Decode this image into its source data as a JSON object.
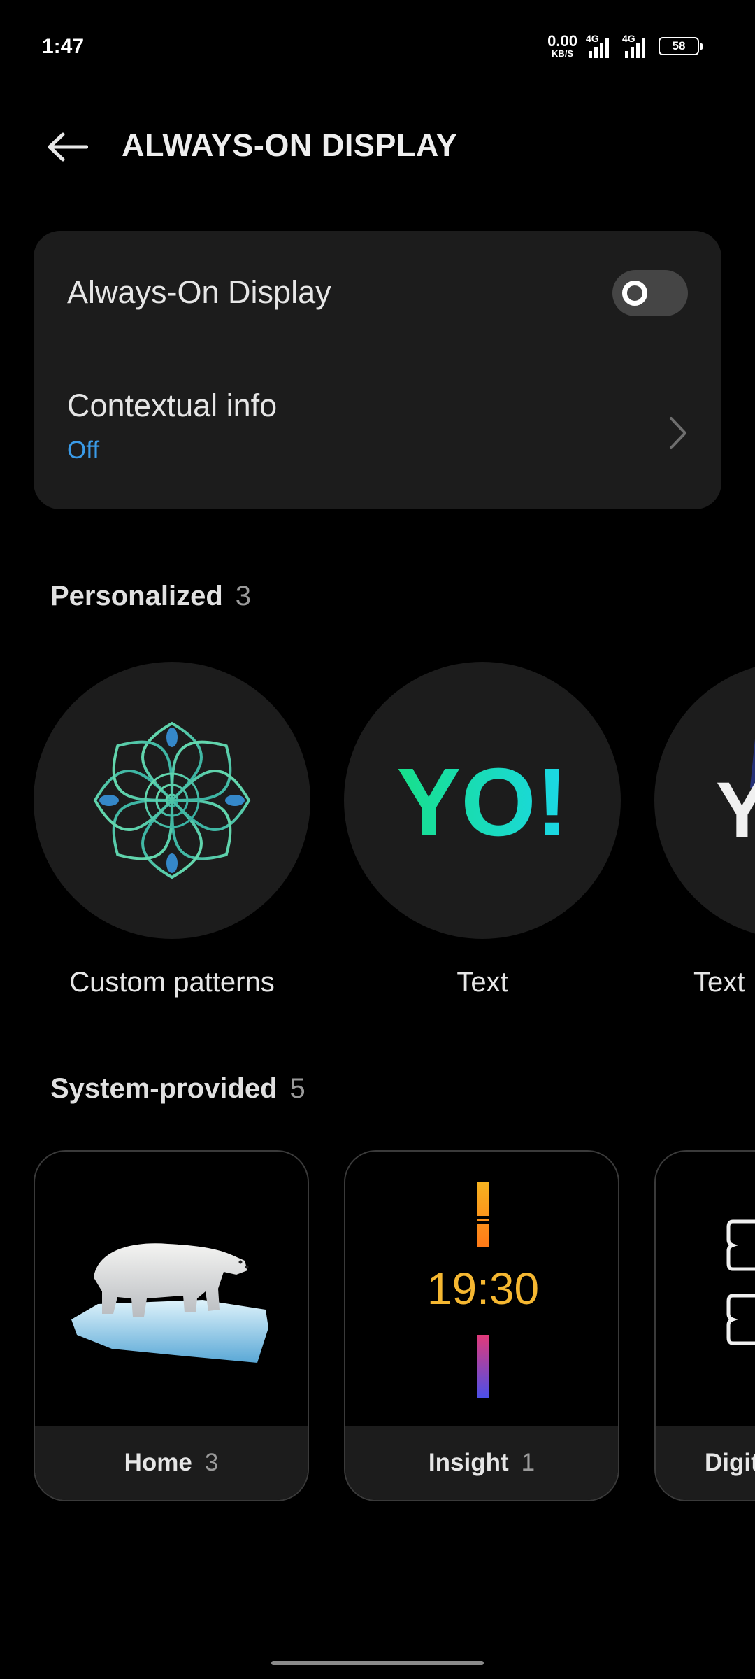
{
  "status_bar": {
    "time": "1:47",
    "net_speed_value": "0.00",
    "net_speed_unit": "KB/S",
    "signal_1_label": "4G",
    "signal_2_label": "4G",
    "battery": "58"
  },
  "header": {
    "title": "ALWAYS-ON DISPLAY"
  },
  "settings": {
    "aod_label": "Always-On Display",
    "aod_enabled": false,
    "contextual_label": "Contextual info",
    "contextual_value": "Off"
  },
  "personalized": {
    "title": "Personalized",
    "count": "3",
    "items": [
      {
        "label": "Custom patterns",
        "icon": "flower-pattern-icon"
      },
      {
        "label": "Text",
        "preview_text": "YO!"
      },
      {
        "label": "Text",
        "preview_text": "Y"
      }
    ]
  },
  "system_provided": {
    "title": "System-provided",
    "count": "5",
    "items": [
      {
        "label": "Home",
        "count": "3",
        "icon": "polar-bear-image"
      },
      {
        "label": "Insight",
        "count": "1",
        "preview_time": "19:30"
      },
      {
        "label": "Digit"
      }
    ]
  },
  "colors": {
    "accent_blue": "#3a9be8",
    "card_bg": "#1c1c1c",
    "yo_green": "#17e08a",
    "yo_cyan": "#1bd7e8",
    "insight_time": "#f5b731"
  }
}
